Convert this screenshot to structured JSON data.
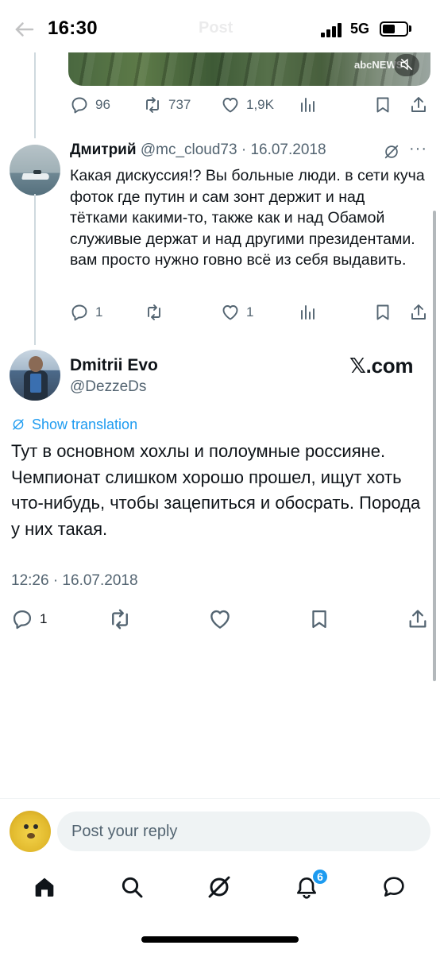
{
  "status_bar": {
    "time": "16:30",
    "network": "5G",
    "ghost_title": "Post",
    "battery_level": 0.55
  },
  "media": {
    "logo_text": "abcNEWS",
    "mute_icon": "muted-speaker-icon"
  },
  "parent_actions": {
    "replies": "96",
    "reposts": "737",
    "likes": "1,9K"
  },
  "reply_tweet": {
    "author_name": "Дмитрий",
    "handle_date": "@mc_cloud73 · 16.07.2018",
    "text": "Какая дискуссия!? Вы больные люди. в сети куча фоток где путин и сам зонт держит и над тётками какими-то, также как и над Обамой служивые держат и над другими президентами. вам просто нужно говно всё из себя выдавить.",
    "replies": "1",
    "reposts": "",
    "likes": "1",
    "more": "···"
  },
  "main_tweet": {
    "author_name": "Dmitrii Evo",
    "handle": "@DezzeDs",
    "brand": "𝕏.com",
    "translate_label": "Show translation",
    "text": "Тут в основном хохлы и полоумные россияне. Чемпионат слишком хорошо прошел,  ищут хоть что-нибудь, чтобы зацепиться и обосрать. Порода у них такая.",
    "timestamp": "12:26 · 16.07.2018",
    "replies": "1"
  },
  "composer": {
    "placeholder": "Post your reply"
  },
  "tab_bar": {
    "items": [
      "home",
      "search",
      "grok",
      "notifications",
      "messages"
    ],
    "notification_badge": "6"
  },
  "colors": {
    "accent": "#1d9bf0",
    "text_primary": "#0f1419",
    "text_secondary": "#536471"
  }
}
